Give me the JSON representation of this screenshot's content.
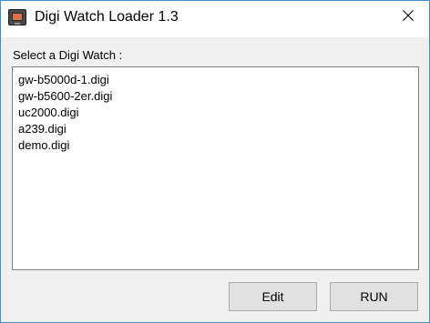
{
  "window": {
    "title": "Digi Watch Loader 1.3",
    "app_icon": "monitor-icon",
    "close_icon": "close-icon",
    "border_color": "#3f8fd8"
  },
  "main": {
    "prompt_label": "Select a Digi Watch :",
    "list_items": [
      "gw-b5000d-1.digi",
      "gw-b5600-2er.digi",
      "uc2000.digi",
      "a239.digi",
      "demo.digi"
    ]
  },
  "buttons": {
    "edit_label": "Edit",
    "run_label": "RUN"
  }
}
